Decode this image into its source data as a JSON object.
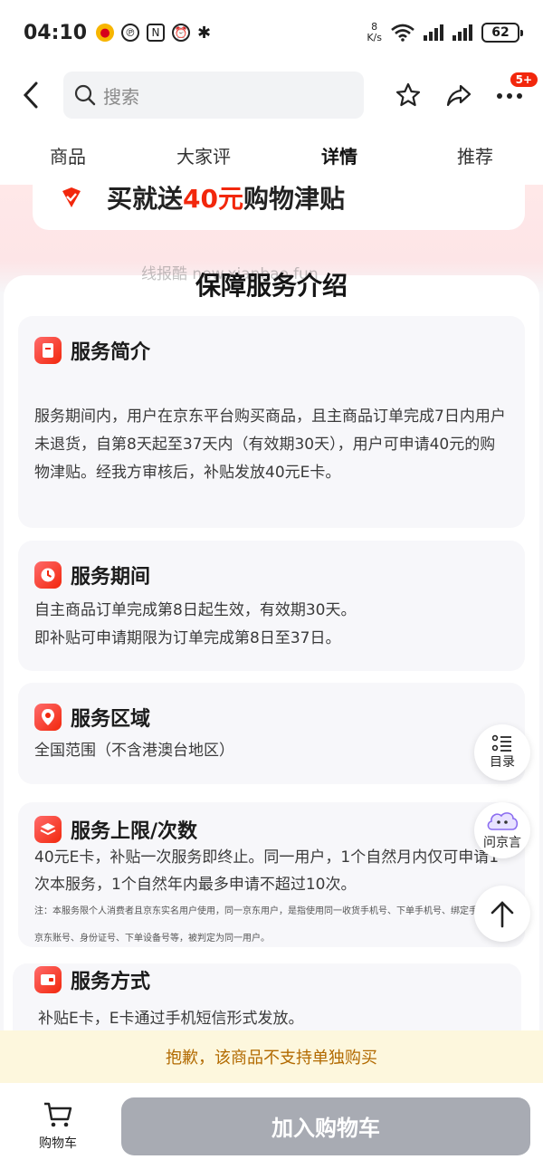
{
  "status_bar": {
    "time": "04:10",
    "netspeed_value": "8",
    "netspeed_unit": "K/s",
    "battery": "62"
  },
  "header": {
    "search_placeholder": "搜索",
    "badge": "5+"
  },
  "tabs": [
    {
      "label": "商品",
      "active": false
    },
    {
      "label": "大家评",
      "active": false
    },
    {
      "label": "详情",
      "active": true
    },
    {
      "label": "推荐",
      "active": false
    }
  ],
  "promo": {
    "prefix": "买就送",
    "amount": "40元",
    "suffix": "购物津贴"
  },
  "watermark": "线报酷 new.xianbao.fun",
  "section_title": "保障服务介绍",
  "cards": [
    {
      "title": "服务简介",
      "icon": "document-icon",
      "body": "服务期间内，用户在京东平台购买商品，且主商品订单完成7日内用户未退货，自第8天起至37天内（有效期30天），用户可申请40元的购物津贴。经我方审核后，补贴发放40元E卡。"
    },
    {
      "title": "服务期间",
      "icon": "clock-icon",
      "body_lines": [
        "自主商品订单完成第8日起生效，有效期30天。",
        "即补贴可申请期限为订单完成第8日至37日。"
      ]
    },
    {
      "title": "服务区域",
      "icon": "location-icon",
      "body": "全国范围（不含港澳台地区）"
    },
    {
      "title": "服务上限/次数",
      "icon": "layers-icon",
      "body": "40元E卡，补贴一次服务即终止。同一用户，1个自然月内仅可申请1次本服务，1个自然年内最多申请不超过10次。",
      "note": "注：本服务限个人消费者且京东实名用户使用，同一京东用户，是指使用同一收货手机号、下单手机号、绑定手机号、京东账号、身份证号、下单设备号等，被判定为同一用户。"
    },
    {
      "title": "服务方式",
      "icon": "wallet-icon",
      "body": "补贴E卡，E卡通过手机短信形式发放。"
    }
  ],
  "floating": {
    "toc_label": "目录",
    "ask_label": "问京言"
  },
  "notice": "抱歉，该商品不支持单独购买",
  "bottom_bar": {
    "cart_label": "购物车",
    "add_cart_label": "加入购物车"
  }
}
